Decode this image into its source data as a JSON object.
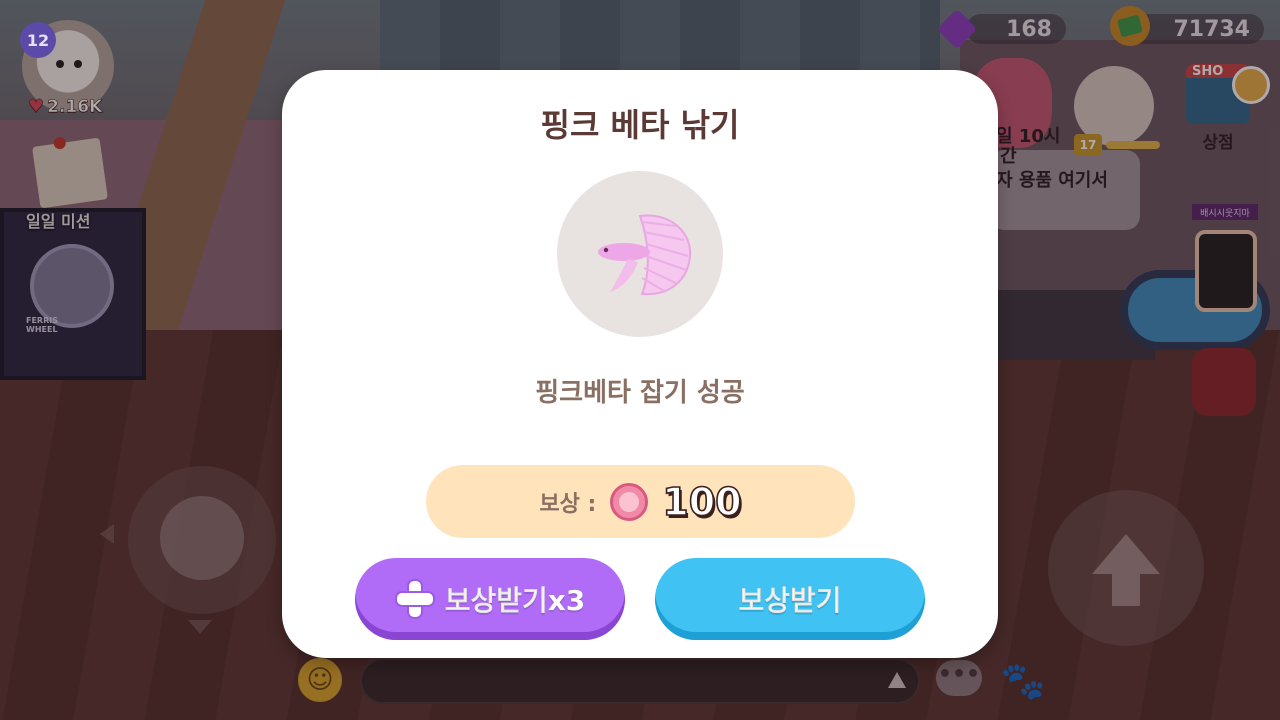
{
  "hud": {
    "player_level": "12",
    "likes": "2.16K",
    "daily_mission": "일일 미션",
    "ferris_text": "FERRIS WHEEL",
    "gems": "168",
    "coins": "71734"
  },
  "scene": {
    "npc_time": "일 10시",
    "npc_time_sub": "간",
    "npc_goods": "자 용품 여기서",
    "npc_level": "17",
    "shop_sign": "SHO",
    "shop_label": "상점",
    "small_sign": "배시시웃지마"
  },
  "modal": {
    "title": "핑크 베타 낚기",
    "fish_icon": "pink-betta-fish",
    "result": "핑크베타 잡기 성공",
    "reward_label": "보상 :",
    "reward_amount": "100",
    "button_x3": "보상받기x3",
    "button_claim": "보상받기"
  },
  "colors": {
    "title": "#5b3a35",
    "reward_bg": "#ffe3bb",
    "button_x3": "#b06cf6",
    "button_claim": "#40c2f2"
  }
}
